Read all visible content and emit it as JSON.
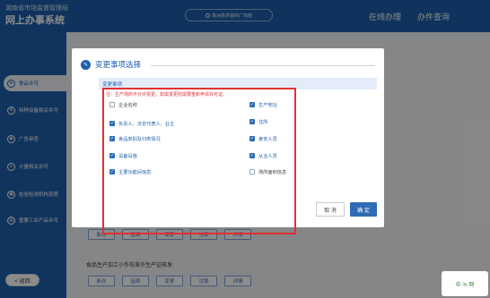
{
  "header": {
    "agency": "湖南省市场监督管理局",
    "system": "网上办事系统",
    "user": "株洲县供销商厂商部",
    "nav": {
      "online": "在线办理",
      "query": "办件查询"
    }
  },
  "sidebar": {
    "items": [
      {
        "label": "食品许可",
        "icon": "document-icon"
      },
      {
        "label": "特种设备相关许可",
        "icon": "gear-icon"
      },
      {
        "label": "广告审查",
        "icon": "megaphone-icon"
      },
      {
        "label": "计量相关许可",
        "icon": "scale-icon"
      },
      {
        "label": "检验检测机构资质",
        "icon": "lab-icon"
      },
      {
        "label": "重要工业产品许可",
        "icon": "factory-icon"
      }
    ],
    "back": "< 返回"
  },
  "main": {
    "btn_row_1": [
      "新办",
      "延续",
      "变更",
      "注销",
      "详情"
    ],
    "section_label": "食品生产加工小作坊准许生产证核发",
    "btn_row_2": [
      "新办",
      "延续",
      "变更",
      "注销",
      "详情"
    ]
  },
  "modal": {
    "title": "变更事项选择",
    "panel_header": "变更事项",
    "warning": "注：生产场所不允许变更，如需变更则需要重新申请许可证。",
    "options_left": [
      {
        "label": "企业名称",
        "checked": false
      },
      {
        "label": "负责人、法定代表人、业主",
        "checked": true
      },
      {
        "label": "食品类别及归类情况",
        "checked": true
      },
      {
        "label": "设备设施",
        "checked": true
      },
      {
        "label": "主要功能间信息",
        "checked": true
      }
    ],
    "options_right": [
      {
        "label": "生产地址",
        "checked": true
      },
      {
        "label": "住所",
        "checked": true
      },
      {
        "label": "食安人员",
        "checked": true
      },
      {
        "label": "从业人员",
        "checked": true
      },
      {
        "label": "场所面积信息",
        "checked": false
      }
    ],
    "cancel": "取 消",
    "confirm": "确 定"
  },
  "corner": {
    "text": "中 % 网"
  },
  "colors": {
    "brand": "#1f5faa",
    "accent": "#2f6cb5",
    "warning": "#e03131"
  }
}
